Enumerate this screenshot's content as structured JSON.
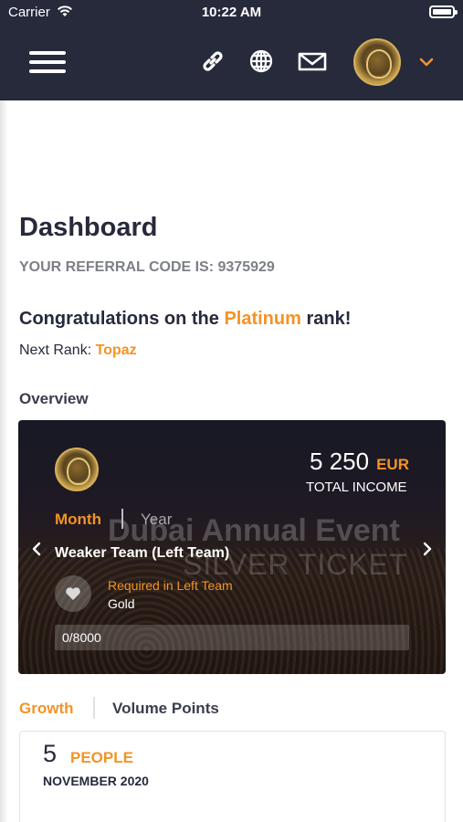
{
  "status_bar": {
    "carrier": "Carrier",
    "time": "10:22 AM"
  },
  "nav": {
    "icons": [
      "menu-icon",
      "link-icon",
      "globe-icon",
      "mail-icon",
      "avatar",
      "chevron-down-icon"
    ]
  },
  "page": {
    "title": "Dashboard",
    "referral_text": "YOUR REFERRAL CODE IS: 9375929",
    "congrats_prefix": "Congratulations on the ",
    "congrats_rank": "Platinum",
    "congrats_suffix": " rank!",
    "next_rank_label": "Next Rank: ",
    "next_rank_value": "Topaz",
    "overview_label": "Overview"
  },
  "overview_card": {
    "amount": "5 250",
    "currency": "EUR",
    "amount_label": "TOTAL INCOME",
    "tabs": [
      "Month",
      "Year"
    ],
    "active_tab": "Month",
    "team_title": "Weaker Team (Left Team)",
    "requirement_label": "Required in Left Team",
    "requirement_value": "Gold",
    "progress_text": "0/8000",
    "progress_fraction": 0,
    "background_text_1": "Dubai Annual Event",
    "background_text_2": "SILVER TICKET"
  },
  "bottom_tabs": {
    "growth": "Growth",
    "volume": "Volume Points",
    "active": "Growth"
  },
  "stat": {
    "number": "5",
    "unit": "PEOPLE",
    "date": "NOVEMBER 2020"
  },
  "colors": {
    "nav_bg": "#262a3b",
    "accent": "#f39327",
    "text_dark": "#262a3b"
  }
}
